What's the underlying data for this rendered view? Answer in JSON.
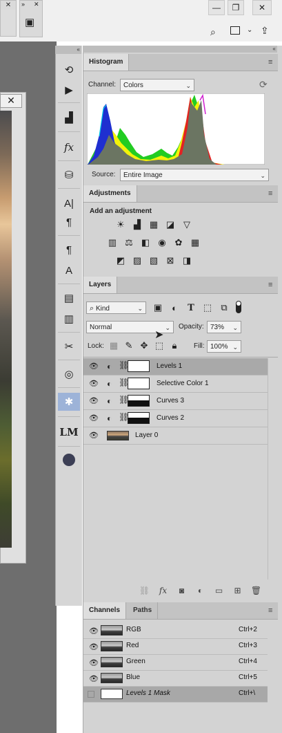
{
  "top": {
    "window_buttons": [
      "—",
      "❐",
      "✕"
    ],
    "close_glyph": "✕",
    "collapse_glyph": "»",
    "doc_close": "✕"
  },
  "histogram": {
    "tab": "Histogram",
    "channel_label": "Channel:",
    "channel_value": "Colors",
    "source_label": "Source:",
    "source_value": "Entire Image",
    "refresh_icon": "refresh-icon"
  },
  "adjustments": {
    "tab": "Adjustments",
    "heading": "Add an adjustment",
    "row1": [
      "brightness-contrast-icon",
      "levels-icon",
      "curves-icon",
      "exposure-icon",
      "triangle-icon"
    ],
    "row2": [
      "vibrance-icon",
      "color-balance-icon",
      "black-white-icon",
      "photo-filter-icon",
      "channel-mixer-icon",
      "color-lookup-icon"
    ],
    "row3": [
      "invert-icon",
      "posterize-icon",
      "threshold-icon",
      "selective-color-icon",
      "gradient-map-icon"
    ]
  },
  "layers": {
    "tab": "Layers",
    "filter_value": "Kind",
    "blend_mode": "Normal",
    "opacity_label": "Opacity:",
    "opacity_value": "73%",
    "lock_label": "Lock:",
    "fill_label": "Fill:",
    "fill_value": "100%",
    "rows": [
      {
        "name": "Levels 1",
        "selected": true
      },
      {
        "name": "Selective Color 1",
        "selected": false
      },
      {
        "name": "Curves 3",
        "selected": false
      },
      {
        "name": "Curves 2",
        "selected": false
      },
      {
        "name": "Layer 0",
        "selected": false
      }
    ]
  },
  "channels": {
    "tab": "Channels",
    "tab2": "Paths",
    "rows": [
      {
        "name": "RGB",
        "key": "Ctrl+2"
      },
      {
        "name": "Red",
        "key": "Ctrl+3"
      },
      {
        "name": "Green",
        "key": "Ctrl+4"
      },
      {
        "name": "Blue",
        "key": "Ctrl+5"
      },
      {
        "name": "Levels 1 Mask",
        "key": "Ctrl+\\"
      }
    ]
  },
  "colors": {
    "histogram_blue": "#1f2fd0",
    "histogram_yellow": "#ffff00",
    "histogram_green": "#1fcc1f",
    "histogram_red": "#e32222",
    "histogram_gray": "#6e7a63"
  }
}
